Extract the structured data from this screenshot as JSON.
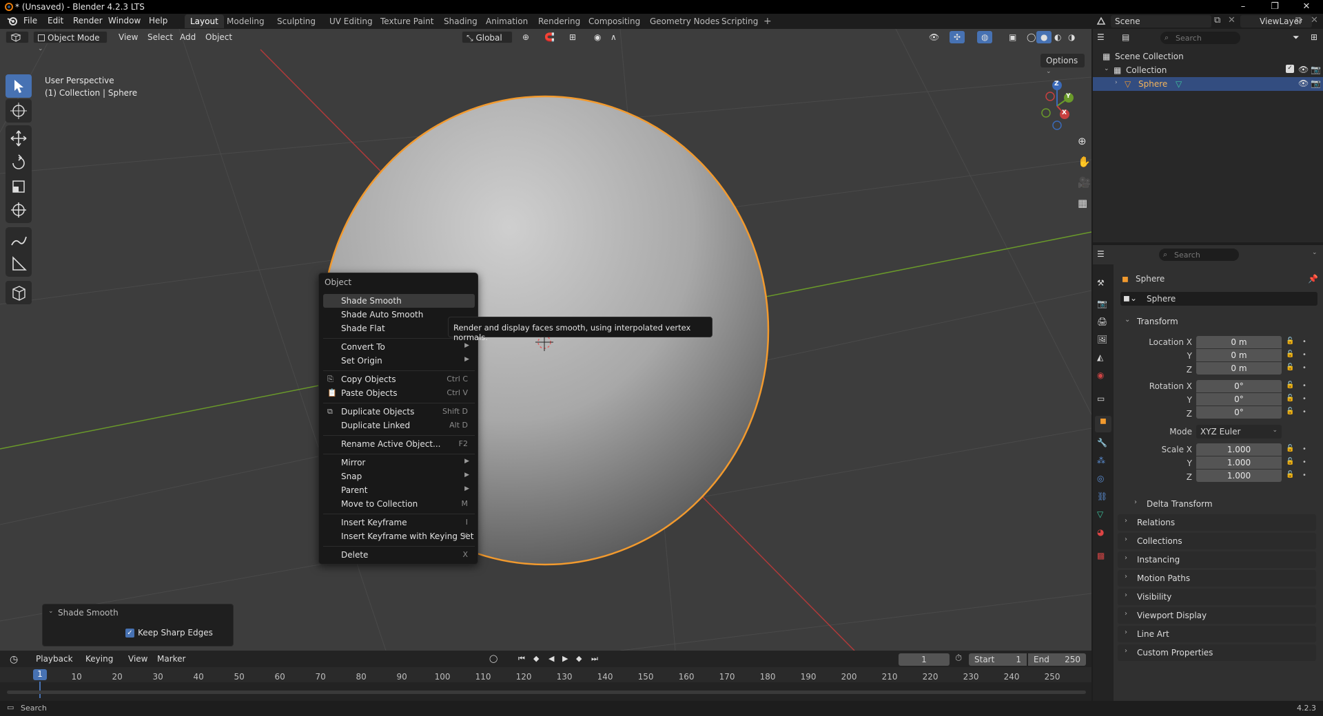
{
  "window": {
    "title": "* (Unsaved) - Blender 4.2.3 LTS",
    "controls": [
      "–",
      "❐",
      "✕"
    ]
  },
  "menu": [
    "File",
    "Edit",
    "Render",
    "Window",
    "Help"
  ],
  "workspaces": [
    "Layout",
    "Modeling",
    "Sculpting",
    "UV Editing",
    "Texture Paint",
    "Shading",
    "Animation",
    "Rendering",
    "Compositing",
    "Geometry Nodes",
    "Scripting"
  ],
  "active_workspace": "Layout",
  "scene": {
    "name": "Scene",
    "view_layer": "ViewLayer"
  },
  "viewport_header": {
    "mode": "Object Mode",
    "menus": [
      "View",
      "Select",
      "Add",
      "Object"
    ],
    "transform_orientation": "Global",
    "options_label": "Options"
  },
  "viewport_overlay": {
    "perspective": "User Perspective",
    "context": "(1) Collection | Sphere"
  },
  "gizmo": {
    "z": "Z",
    "y": "Y",
    "x": "X"
  },
  "context_menu": {
    "title": "Object",
    "items": [
      {
        "label": "Shade Smooth",
        "shortcut": "",
        "submenu": false
      },
      {
        "label": "Shade Auto Smooth",
        "shortcut": "",
        "submenu": false
      },
      {
        "label": "Shade Flat",
        "shortcut": "",
        "submenu": false
      },
      {
        "label": "Convert To",
        "shortcut": "",
        "submenu": true
      },
      {
        "label": "Set Origin",
        "shortcut": "",
        "submenu": true
      },
      {
        "label": "Copy Objects",
        "shortcut": "Ctrl C",
        "submenu": false
      },
      {
        "label": "Paste Objects",
        "shortcut": "Ctrl V",
        "submenu": false
      },
      {
        "label": "Duplicate Objects",
        "shortcut": "Shift D",
        "submenu": false
      },
      {
        "label": "Duplicate Linked",
        "shortcut": "Alt D",
        "submenu": false
      },
      {
        "label": "Rename Active Object...",
        "shortcut": "F2",
        "submenu": false
      },
      {
        "label": "Mirror",
        "shortcut": "",
        "submenu": true
      },
      {
        "label": "Snap",
        "shortcut": "",
        "submenu": true
      },
      {
        "label": "Parent",
        "shortcut": "",
        "submenu": true
      },
      {
        "label": "Move to Collection",
        "shortcut": "M",
        "submenu": false
      },
      {
        "label": "Insert Keyframe",
        "shortcut": "I",
        "submenu": false
      },
      {
        "label": "Insert Keyframe with Keying Set",
        "shortcut": "K",
        "submenu": false
      },
      {
        "label": "Delete",
        "shortcut": "X",
        "submenu": false
      }
    ]
  },
  "tooltip": "Render and display faces smooth, using interpolated vertex normals.",
  "last_operator": {
    "title": "Shade Smooth",
    "option_label": "Keep Sharp Edges",
    "option_checked": true
  },
  "timeline": {
    "menus": [
      "Playback",
      "Keying",
      "View",
      "Marker"
    ],
    "current_frame": "1",
    "start_label": "Start",
    "start": "1",
    "end_label": "End",
    "end": "250",
    "ruler": [
      "1",
      "10",
      "20",
      "30",
      "40",
      "50",
      "60",
      "70",
      "80",
      "90",
      "100",
      "110",
      "120",
      "130",
      "140",
      "150",
      "160",
      "170",
      "180",
      "190",
      "200",
      "210",
      "220",
      "230",
      "240",
      "250"
    ]
  },
  "status": {
    "search": "Search",
    "version": "4.2.3"
  },
  "outliner": {
    "search_placeholder": "Search",
    "scene_collection": "Scene Collection",
    "collection": "Collection",
    "object": "Sphere"
  },
  "properties": {
    "search_placeholder": "Search",
    "object_name": "Sphere",
    "data_name": "Sphere",
    "transform_title": "Transform",
    "location_label": "Location X",
    "location": [
      "0 m",
      "0 m",
      "0 m"
    ],
    "rotation_label": "Rotation X",
    "rotation": [
      "0°",
      "0°",
      "0°"
    ],
    "mode_label": "Mode",
    "mode_value": "XYZ Euler",
    "scale_label": "Scale X",
    "scale": [
      "1.000",
      "1.000",
      "1.000"
    ],
    "axis_y": "Y",
    "axis_z": "Z",
    "delta_transform": "Delta Transform",
    "panels": [
      "Relations",
      "Collections",
      "Instancing",
      "Motion Paths",
      "Visibility",
      "Viewport Display",
      "Line Art",
      "Custom Properties"
    ]
  },
  "colors": {
    "accent": "#4772b3",
    "selection_outline": "#f29a2e",
    "viewport_bg": "#3d3d3d",
    "axis_x": "#b03a3a",
    "axis_y": "#6a9a2a"
  }
}
